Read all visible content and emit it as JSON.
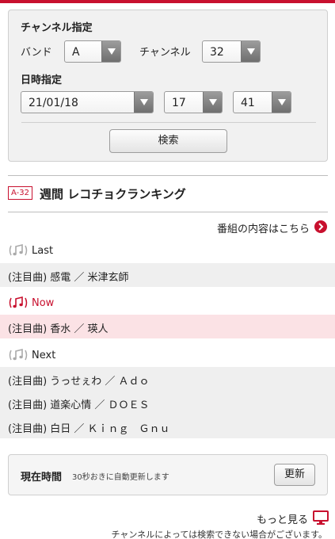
{
  "search": {
    "heading": "チャンネル指定",
    "band_label": "バンド",
    "band_value": "A",
    "channel_label": "チャンネル",
    "channel_value": "32",
    "datetime_label": "日時指定",
    "date_value": "21/01/18",
    "hour_value": "17",
    "minute_value": "41",
    "search_button": "検索"
  },
  "ranking": {
    "channel_badge": "A-32",
    "title": "週間 レコチョクランキング",
    "program_link": "番組の内容はこちら"
  },
  "tracks": {
    "last_label": "Last",
    "last": [
      {
        "text": "(注目曲) 感電 ／ 米津玄師"
      }
    ],
    "now_label": "Now",
    "now": [
      {
        "text": "(注目曲) 香水 ／ 瑛人"
      }
    ],
    "next_label": "Next",
    "next": [
      {
        "text": "(注目曲) うっせぇわ ／ Ａｄｏ"
      },
      {
        "text": "(注目曲) 道楽心情 ／ ＤＯＥＳ"
      },
      {
        "text": "(注目曲) 白日 ／ Ｋｉｎｇ　Ｇｎｕ"
      }
    ]
  },
  "time_box": {
    "label": "現在時間",
    "note": "30秒おきに自動更新します",
    "refresh_button": "更新"
  },
  "footer": {
    "more_link": "もっと見る",
    "notice": "チャンネルによっては検索できない場合がございます。"
  },
  "colors": {
    "accent": "#c8102e",
    "highlight_row": "#fbe2e5",
    "row_bg": "#efefef"
  }
}
